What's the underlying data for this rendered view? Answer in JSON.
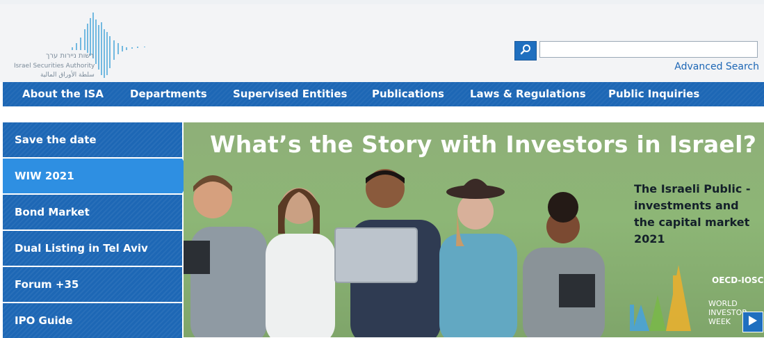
{
  "header": {
    "logo_text_he": "רשות ניירות ערך",
    "logo_text_en": "Israel Securities Authority",
    "logo_text_ar": "سلطة الأوراق المالية",
    "search_placeholder": "",
    "advanced_search": "Advanced Search"
  },
  "nav": {
    "items": [
      {
        "label": "About the ISA"
      },
      {
        "label": "Departments"
      },
      {
        "label": "Supervised Entities"
      },
      {
        "label": "Publications"
      },
      {
        "label": "Laws & Regulations"
      },
      {
        "label": "Public Inquiries"
      }
    ]
  },
  "sidebar": {
    "items": [
      {
        "label": "Save the date"
      },
      {
        "label": "WIW 2021"
      },
      {
        "label": "Bond Market"
      },
      {
        "label": "Dual Listing in Tel Aviv"
      },
      {
        "label": "Forum +35"
      },
      {
        "label": "IPO Guide"
      }
    ],
    "active_index": 1
  },
  "banner": {
    "title": "What’s the Story with Investors in Israel?",
    "subtitle": "The Israeli Public -investments and the capital market 2021",
    "oecd_label": "OECD-IOSCO",
    "wiw_label": "WORLD INVESTOR WEEK"
  },
  "colors": {
    "brand_blue": "#1d67b5",
    "active_blue": "#2e8fe2",
    "banner_green": "#8db676",
    "link_blue": "#1c66b5"
  },
  "icons": {
    "search": "search-icon",
    "play": "play-icon"
  }
}
